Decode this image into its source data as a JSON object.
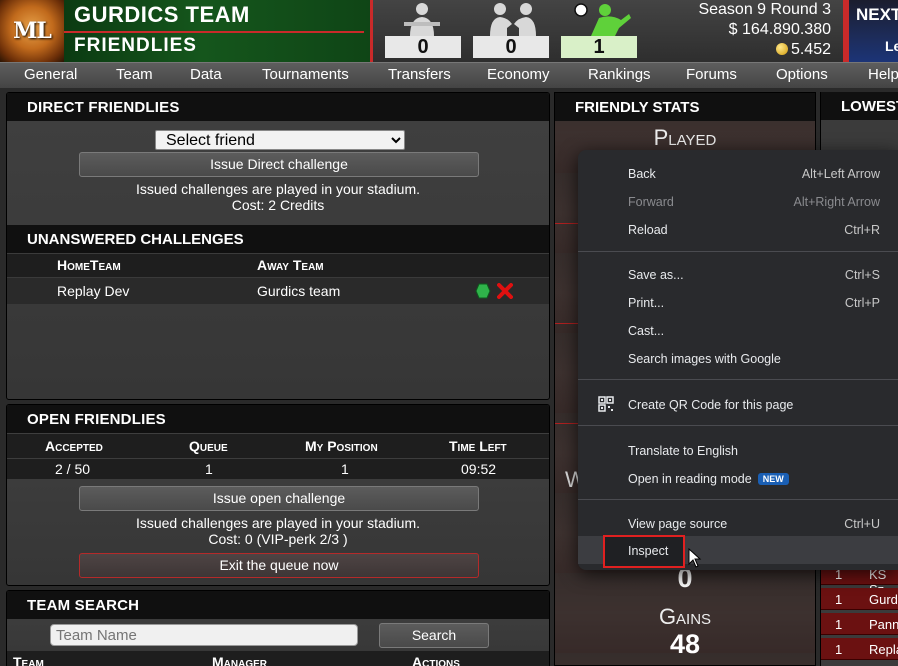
{
  "header": {
    "logo_text": "ML",
    "team_name": "GURDICS TEAM",
    "page_subtitle": "FRIENDLIES",
    "record": {
      "losses": "0",
      "draws": "0",
      "wins": "1"
    },
    "season_round": "Season 9 Round 3",
    "money": "$ 164.890.380",
    "credits": "5.452",
    "next_label": "NEXT",
    "next_sub": "Le"
  },
  "nav": [
    "General",
    "Team",
    "Data",
    "Tournaments",
    "Transfers",
    "Economy",
    "Rankings",
    "Forums",
    "Options",
    "Help"
  ],
  "direct_friendlies": {
    "title": "DIRECT FRIENDLIES",
    "select_value": "Select friend",
    "button": "Issue Direct challenge",
    "info_line1": "Issued challenges are played in your stadium.",
    "info_line2": "Cost: 2 Credits"
  },
  "unanswered": {
    "title": "UNANSWERED CHALLENGES",
    "col_home": "HomeTeam",
    "col_away": "Away Team",
    "rows": [
      {
        "home": "Replay Dev",
        "away": "Gurdics team"
      }
    ]
  },
  "open_friendlies": {
    "title": "OPEN FRIENDLIES",
    "col_accepted": "Accepted",
    "col_queue": "Queue",
    "col_position": "My Position",
    "col_time": "Time Left",
    "accepted": "2 / 50",
    "queue": "1",
    "position": "1",
    "time_left": "09:52",
    "button_issue": "Issue open challenge",
    "info_line1": "Issued challenges are played in your stadium.",
    "info_line2": "Cost: 0 (VIP-perk 2/3 )",
    "button_exit": "Exit the queue now"
  },
  "team_search": {
    "title": "TEAM SEARCH",
    "placeholder": "Team Name",
    "button": "Search",
    "col_team": "Team",
    "col_manager": "Manager",
    "col_actions": "Actions"
  },
  "friendly_stats": {
    "title": "FRIENDLY STATS",
    "played_label": "Played",
    "partial_label": "W",
    "bottom_value": "0",
    "gains_label": "Gains",
    "gains_value": "48"
  },
  "lowest": {
    "title": "LOWEST",
    "rows": [
      {
        "rank": "1",
        "team": "KS Sz"
      },
      {
        "rank": "1",
        "team": "Gurd"
      },
      {
        "rank": "1",
        "team": "Pann"
      },
      {
        "rank": "1",
        "team": "Repla"
      }
    ]
  },
  "context_menu": {
    "items": [
      {
        "label": "Back",
        "shortcut": "Alt+Left Arrow"
      },
      {
        "label": "Forward",
        "shortcut": "Alt+Right Arrow"
      },
      {
        "label": "Reload",
        "shortcut": "Ctrl+R"
      },
      {
        "label": "Save as...",
        "shortcut": "Ctrl+S"
      },
      {
        "label": "Print...",
        "shortcut": "Ctrl+P"
      },
      {
        "label": "Cast..."
      },
      {
        "label": "Search images with Google"
      },
      {
        "label": "Create QR Code for this page"
      },
      {
        "label": "Translate to English"
      },
      {
        "label": "Open in reading mode",
        "badge": "NEW"
      },
      {
        "label": "View page source",
        "shortcut": "Ctrl+U"
      },
      {
        "label": "Inspect"
      }
    ]
  },
  "colors": {
    "accent_red": "#c92a2a",
    "team_green": "#15561c",
    "menu_bg": "#292a2d",
    "accept_green": "#2fb34a",
    "decline_red": "#e01010"
  }
}
